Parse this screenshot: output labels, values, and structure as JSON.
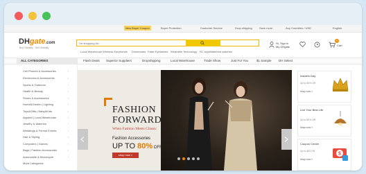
{
  "top_strip": {
    "new_buyer_coupon": "New Buyer Coupon",
    "buyer_protection": "Buyer Protection",
    "customer_service": "Customer Service",
    "drop_shipping": "Drop shipping",
    "save_more": "Save more",
    "country": "Any Countries / USD",
    "language": "English"
  },
  "header": {
    "logo_dh": "DH",
    "logo_gate": "gate",
    "logo_com": ".com",
    "logo_tagline": "Buy Globally · Sell Globally",
    "search_placeholder": "I'm shopping for...",
    "quick_links": [
      "Local Warehouse",
      "Wireless Earphones",
      "Dinnerware",
      "False Eyelashes",
      "Wearable Technology",
      "RC toys",
      "Waterbird watches"
    ],
    "signin_line1": "Hi, Sign in",
    "signin_line2": "My DHgate",
    "cart_count": "0",
    "cart_label": "Cart"
  },
  "nav": {
    "all_categories": "ALL CATEGORIES",
    "items": [
      "Flash Deals",
      "Superior Suppliers",
      "Dropshipping",
      "Local Warehouse",
      "Trade Show",
      "Just For You",
      "$1 Sample",
      "DH Select"
    ]
  },
  "categories": [
    "Cell Phones & Accessories",
    "Electronics & Accessories",
    "Sports & Outdoors",
    "Health & Beauty",
    "Shoes & Accessories",
    "Home&Garden | Lighting",
    "Toys&Gifts | Baby&Kids",
    "Apparel | Local Warehouse",
    "Jewelry & Watches",
    "Weddings & Formal Events",
    "Hair & Styling",
    "Computers | Games",
    "Bags | Fashion Accessories",
    "Automobile & Motorcycle",
    "More Categories"
  ],
  "banner": {
    "line1": "FASHION",
    "line2": "FORWARD",
    "subtitle": "When Fashion Meets Classic",
    "accessories": "Fashion Accessories",
    "upto": "UP TO ",
    "pct": "80%",
    "off": " OFF",
    "shop_now": "shop now »"
  },
  "promos": [
    {
      "title": "Insiders Day",
      "sub": "Up to 80% Off",
      "shop": "shop now »"
    },
    {
      "title": "Live Your Best Life",
      "sub": "Up to 80% Off",
      "shop": "shop now »"
    },
    {
      "title": "Coupon Center",
      "sub": "Up to $20 Off",
      "shop": "shop now »"
    }
  ],
  "colors": {
    "accent": "#f28a00",
    "search_border": "#f2b600",
    "banner_red": "#c0392b"
  }
}
